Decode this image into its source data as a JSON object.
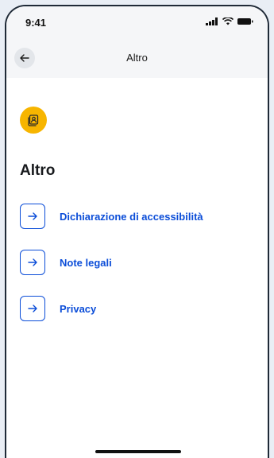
{
  "status_bar": {
    "time": "9:41"
  },
  "nav": {
    "title": "Altro"
  },
  "page": {
    "title": "Altro"
  },
  "links": [
    {
      "label": "Dichiarazione di accessibilità"
    },
    {
      "label": "Note legali"
    },
    {
      "label": "Privacy"
    }
  ],
  "colors": {
    "accent": "#0b4dd8",
    "section_icon_bg": "#f7b500",
    "header_bg": "#f5f6f8"
  },
  "icons": {
    "back": "arrow-left-icon",
    "section": "contacts-book-icon",
    "link": "arrow-right-icon"
  }
}
